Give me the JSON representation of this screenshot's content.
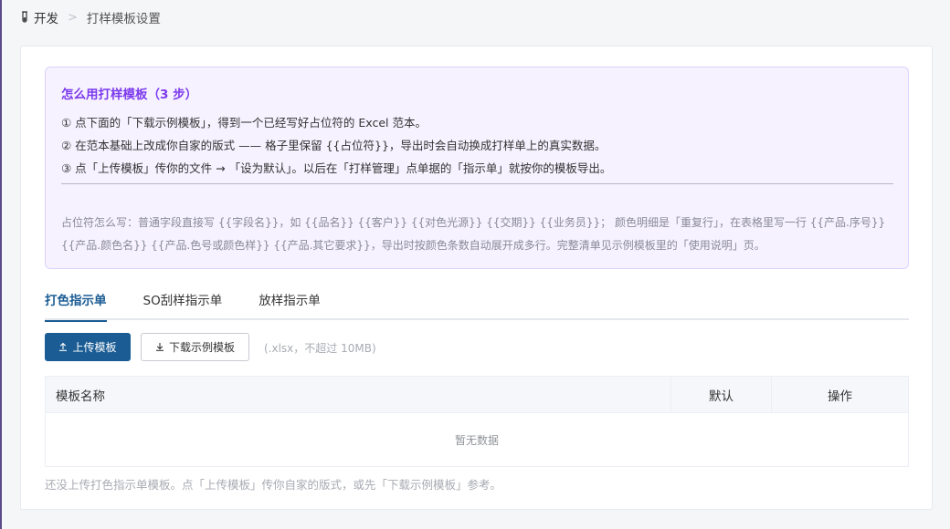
{
  "breadcrumb": {
    "root": "开发",
    "current": "打样模板设置"
  },
  "howto": {
    "title": "怎么用打样模板（3 步）",
    "steps": [
      "① 点下面的「下载示例模板」，得到一个已经写好占位符的 Excel 范本。",
      "② 在范本基础上改成你自家的版式 —— 格子里保留 {{占位符}}，导出时会自动换成打样单上的真实数据。",
      "③ 点「上传模板」传你的文件 → 「设为默认」。以后在「打样管理」点单据的「指示单」就按你的模板导出。"
    ],
    "note": "占位符怎么写：普通字段直接写 {{字段名}}，如 {{品名}} {{客户}} {{对色光源}} {{交期}} {{业务员}}； 颜色明细是「重复行」，在表格里写一行 {{产品.序号}} {{产品.颜色名}} {{产品.色号或颜色样}} {{产品.其它要求}}，导出时按颜色条数自动展开成多行。完整清单见示例模板里的「使用说明」页。"
  },
  "tabs": [
    {
      "label": "打色指示单",
      "active": true
    },
    {
      "label": "SO刮样指示单",
      "active": false
    },
    {
      "label": "放样指示单",
      "active": false
    }
  ],
  "toolbar": {
    "upload_label": "上传模板",
    "download_label": "下载示例模板",
    "hint": "(.xlsx，不超过 10MB)"
  },
  "table": {
    "columns": [
      "模板名称",
      "默认",
      "操作"
    ],
    "empty_text": "暂无数据"
  },
  "footnote": "还没上传打色指示单模板。点「上传模板」传你自家的版式，或先「下载示例模板」参考。",
  "colors": {
    "primary": "#1b5c94",
    "accent": "#7c3aed",
    "howto_bg": "#f6f2ff"
  }
}
